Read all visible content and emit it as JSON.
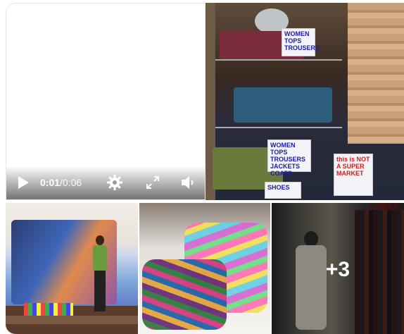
{
  "video": {
    "current_time": "0:01",
    "separator": " / ",
    "duration": "0:06"
  },
  "store_signs": {
    "sign_1": "WOMEN TOPS TROUSERS",
    "sign_2": "WOMEN TOPS TROUSERS JACKETS COATS",
    "sign_3": "this is NOT A SUPER MARKET",
    "sign_4": "SHOES"
  },
  "gallery": {
    "more_count": "+3"
  },
  "icons": {
    "play": "play-icon",
    "settings": "gear-icon",
    "fullscreen": "expand-icon",
    "volume": "volume-icon"
  }
}
